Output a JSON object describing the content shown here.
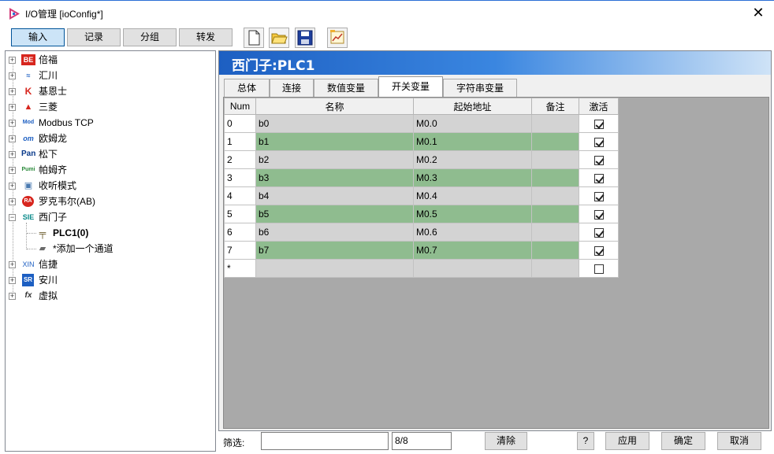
{
  "window": {
    "title": "I/O管理 [ioConfig*]",
    "close_glyph": "✕"
  },
  "toolbar": {
    "tabs": [
      {
        "label": "输入",
        "active": true
      },
      {
        "label": "记录",
        "active": false
      },
      {
        "label": "分组",
        "active": false
      },
      {
        "label": "转发",
        "active": false
      }
    ],
    "icons": [
      "new-file-icon",
      "open-folder-icon",
      "save-icon",
      "chart-icon"
    ]
  },
  "tree": {
    "items": [
      {
        "label": "倍福",
        "icon": "beckhoff-icon",
        "badge": "BE"
      },
      {
        "label": "汇川",
        "icon": "inovance-icon",
        "badge": "≈"
      },
      {
        "label": "基恩士",
        "icon": "keyence-icon",
        "badge": "K"
      },
      {
        "label": "三菱",
        "icon": "mitsubishi-icon",
        "badge": "▲"
      },
      {
        "label": "Modbus TCP",
        "icon": "modbus-icon",
        "badge": "Mod"
      },
      {
        "label": "欧姆龙",
        "icon": "omron-icon",
        "badge": "om"
      },
      {
        "label": "松下",
        "icon": "panasonic-icon",
        "badge": "Pan"
      },
      {
        "label": "帕姆齐",
        "icon": "pumi-icon",
        "badge": "Pumi"
      },
      {
        "label": "收听模式",
        "icon": "listen-icon",
        "badge": "▣"
      },
      {
        "label": "罗克韦尔(AB)",
        "icon": "rockwell-icon",
        "badge": "RA"
      },
      {
        "label": "西门子",
        "icon": "siemens-icon",
        "badge": "SIE"
      },
      {
        "label": "PLC1(0)",
        "icon": "plc-icon",
        "badge": "╤"
      },
      {
        "label": "*添加一个通道",
        "icon": "add-channel-icon",
        "badge": "▰"
      },
      {
        "label": "信捷",
        "icon": "xinje-icon",
        "badge": "XIN"
      },
      {
        "label": "安川",
        "icon": "yaskawa-icon",
        "badge": "SR"
      },
      {
        "label": "虚拟",
        "icon": "virtual-icon",
        "badge": "fx"
      }
    ]
  },
  "panel": {
    "title": "西门子:PLC1",
    "tabs": [
      "总体",
      "连接",
      "数值变量",
      "开关变量",
      "字符串变量"
    ],
    "active_tab": "开关变量"
  },
  "grid": {
    "columns": [
      "Num",
      "名称",
      "起始地址",
      "备注",
      "激活"
    ],
    "rows": [
      {
        "num": "0",
        "name": "b0",
        "addr": "M0.0",
        "note": "",
        "active": true
      },
      {
        "num": "1",
        "name": "b1",
        "addr": "M0.1",
        "note": "",
        "active": true
      },
      {
        "num": "2",
        "name": "b2",
        "addr": "M0.2",
        "note": "",
        "active": true
      },
      {
        "num": "3",
        "name": "b3",
        "addr": "M0.3",
        "note": "",
        "active": true
      },
      {
        "num": "4",
        "name": "b4",
        "addr": "M0.4",
        "note": "",
        "active": true
      },
      {
        "num": "5",
        "name": "b5",
        "addr": "M0.5",
        "note": "",
        "active": true
      },
      {
        "num": "6",
        "name": "b6",
        "addr": "M0.6",
        "note": "",
        "active": true
      },
      {
        "num": "7",
        "name": "b7",
        "addr": "M0.7",
        "note": "",
        "active": true
      }
    ],
    "new_row_marker": "*"
  },
  "footer": {
    "filter_label": "筛选:",
    "filter_value": "",
    "count": "8/8",
    "clear": "清除",
    "help": "?",
    "apply": "应用",
    "ok": "确定",
    "cancel": "取消"
  },
  "colors": {
    "row_gray": "#d3d3d3",
    "row_green": "#8fbc8f",
    "header_blue": "#1d5fc2"
  }
}
